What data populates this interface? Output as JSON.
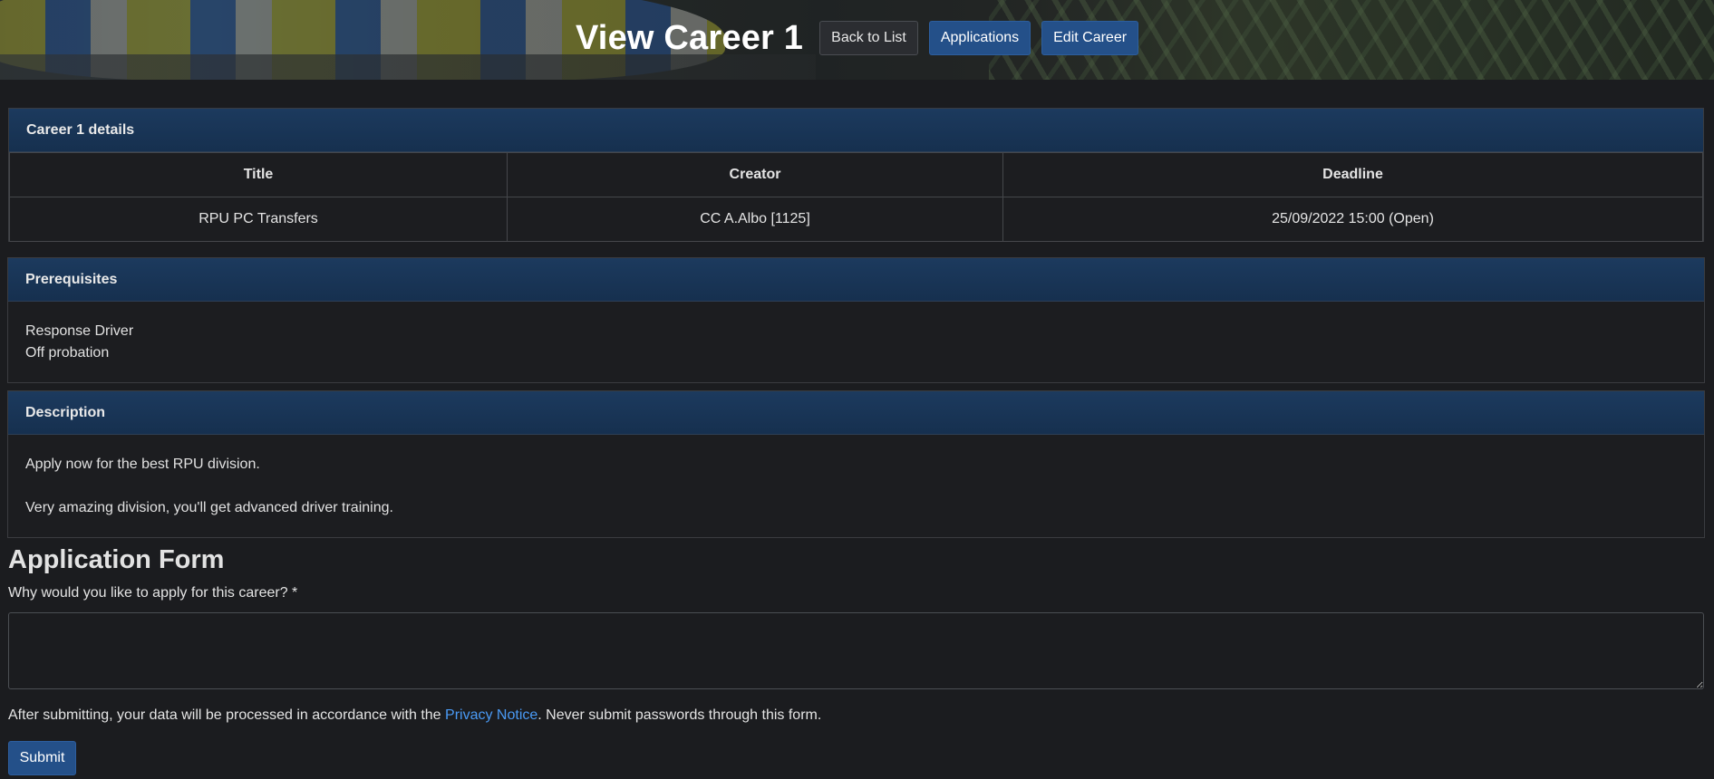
{
  "header": {
    "title": "View Career 1",
    "back_label": "Back to List",
    "applications_label": "Applications",
    "edit_label": "Edit Career"
  },
  "details": {
    "heading": "Career 1 details",
    "columns": [
      "Title",
      "Creator",
      "Deadline"
    ],
    "row": [
      "RPU PC Transfers",
      "CC A.Albo [1125]",
      "25/09/2022 15:00 (Open)"
    ]
  },
  "prerequisites": {
    "heading": "Prerequisites",
    "items": [
      "Response Driver",
      "Off probation"
    ]
  },
  "description": {
    "heading": "Description",
    "lines": [
      "Apply now for the best RPU division.",
      "Very amazing division, you'll get advanced driver training."
    ]
  },
  "form": {
    "title": "Application Form",
    "question_label": "Why would you like to apply for this career? *",
    "answer_value": "",
    "privacy_prefix": "After submitting, your data will be processed in accordance with the ",
    "privacy_link": "Privacy Notice",
    "privacy_suffix": ". Never submit passwords through this form.",
    "submit_label": "Submit"
  },
  "colors": {
    "background": "#1b1c1f",
    "panel_header": "#1c3a5e",
    "primary_button": "#245089",
    "link": "#4a9af5"
  }
}
